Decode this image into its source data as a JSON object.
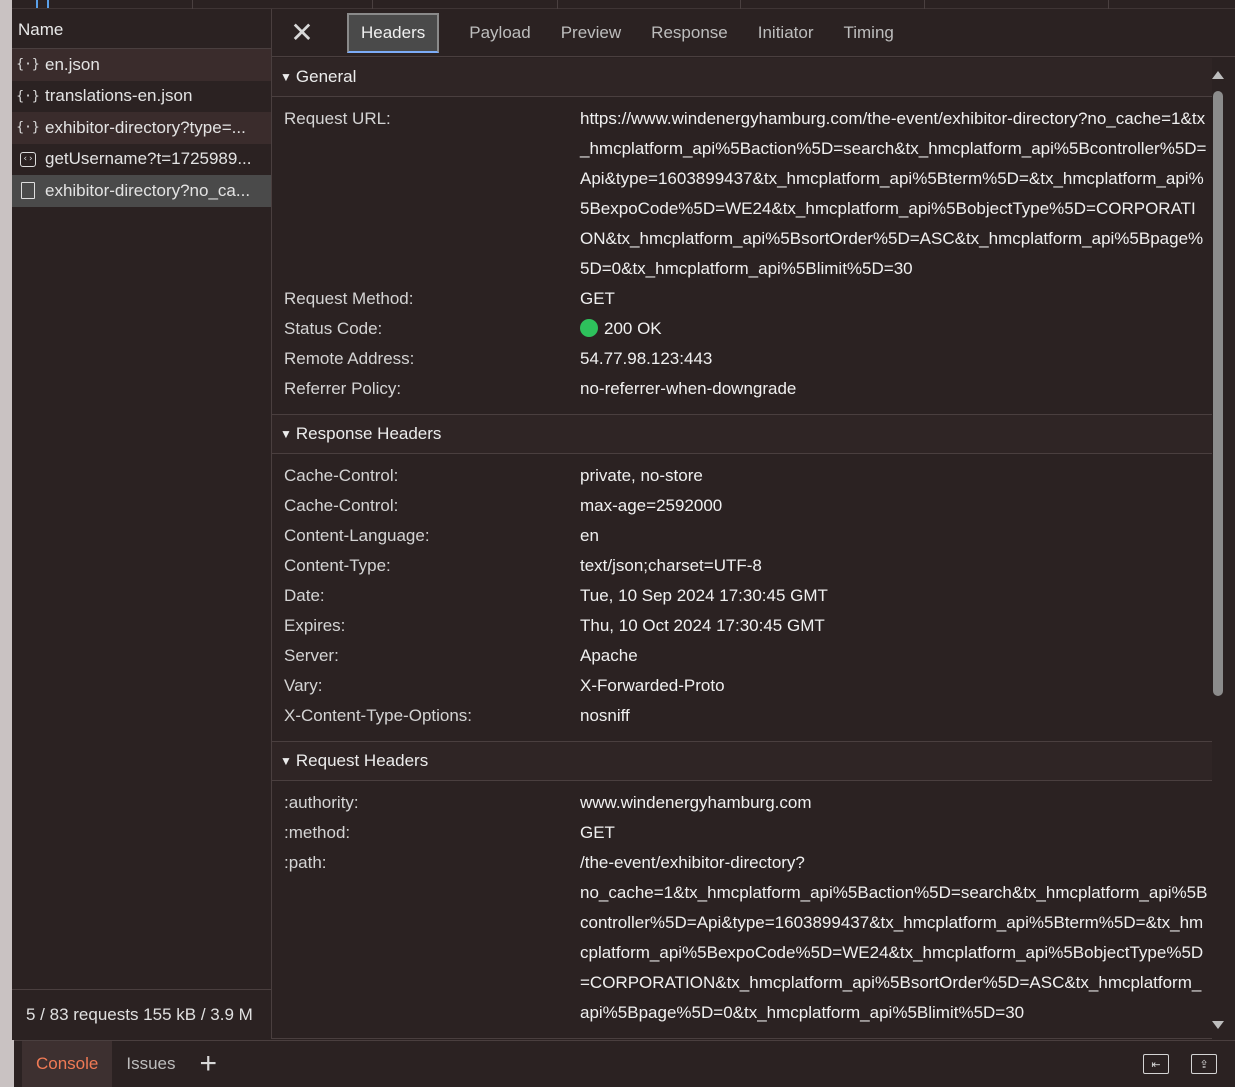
{
  "request_list": {
    "header": "Name",
    "items": [
      {
        "icon": "json-icon",
        "label": "en.json"
      },
      {
        "icon": "json-icon",
        "label": "translations-en.json"
      },
      {
        "icon": "json-icon",
        "label": "exhibitor-directory?type=..."
      },
      {
        "icon": "script-icon",
        "label": "getUsername?t=1725989..."
      },
      {
        "icon": "document-icon",
        "label": "exhibitor-directory?no_ca..."
      }
    ],
    "footer": "5 / 83 requests  155 kB / 3.9 M"
  },
  "tabs": [
    "Headers",
    "Payload",
    "Preview",
    "Response",
    "Initiator",
    "Timing"
  ],
  "close_glyph": "✕",
  "sections": {
    "general": {
      "title": "General",
      "rows": [
        {
          "k": "Request URL:",
          "v": "https://www.windenergyhamburg.com/the-event/exhibitor-directory?no_cache=1&tx_hmcplatform_api%5Baction%5D=search&tx_hmcplatform_api%5Bcontroller%5D=Api&type=1603899437&tx_hmcplatform_api%5Bterm%5D=&tx_hmcplatform_api%5BexpoCode%5D=WE24&tx_hmcplatform_api%5BobjectType%5D=CORPORATION&tx_hmcplatform_api%5BsortOrder%5D=ASC&tx_hmcplatform_api%5Bpage%5D=0&tx_hmcplatform_api%5Blimit%5D=30"
        },
        {
          "k": "Request Method:",
          "v": "GET"
        },
        {
          "k": "Status Code:",
          "v": "200 OK"
        },
        {
          "k": "Remote Address:",
          "v": "54.77.98.123:443"
        },
        {
          "k": "Referrer Policy:",
          "v": "no-referrer-when-downgrade"
        }
      ]
    },
    "response": {
      "title": "Response Headers",
      "rows": [
        {
          "k": "Cache-Control:",
          "v": "private, no-store"
        },
        {
          "k": "Cache-Control:",
          "v": "max-age=2592000"
        },
        {
          "k": "Content-Language:",
          "v": "en"
        },
        {
          "k": "Content-Type:",
          "v": "text/json;charset=UTF-8"
        },
        {
          "k": "Date:",
          "v": "Tue, 10 Sep 2024 17:30:45 GMT"
        },
        {
          "k": "Expires:",
          "v": "Thu, 10 Oct 2024 17:30:45 GMT"
        },
        {
          "k": "Server:",
          "v": "Apache"
        },
        {
          "k": "Vary:",
          "v": "X-Forwarded-Proto"
        },
        {
          "k": "X-Content-Type-Options:",
          "v": "nosniff"
        }
      ]
    },
    "request": {
      "title": "Request Headers",
      "rows": [
        {
          "k": ":authority:",
          "v": "www.windenergyhamburg.com"
        },
        {
          "k": ":method:",
          "v": "GET"
        },
        {
          "k": ":path:",
          "v": "/the-event/exhibitor-directory?"
        },
        {
          "k": "",
          "v": "no_cache=1&tx_hmcplatform_api%5Baction%5D=search&tx_hmcplatform_api%5Bcontroller%5D=Api&type=1603899437&tx_hmcplatform_api%5Bterm%5D=&tx_hmcplatform_api%5BexpoCode%5D=WE24&tx_hmcplatform_api%5BobjectType%5D=CORPORATION&tx_hmcplatform_api%5BsortOrder%5D=ASC&tx_hmcplatform_api%5Bpage%5D=0&tx_hmcplatform_api%5Blimit%5D=30"
        }
      ]
    }
  },
  "drawer": {
    "tabs": [
      "Console",
      "Issues"
    ],
    "add_glyph": "+"
  },
  "colors": {
    "status_ok": "#2ec15c",
    "console_accent": "#f07a55",
    "tab_underline": "#7cacf8"
  }
}
